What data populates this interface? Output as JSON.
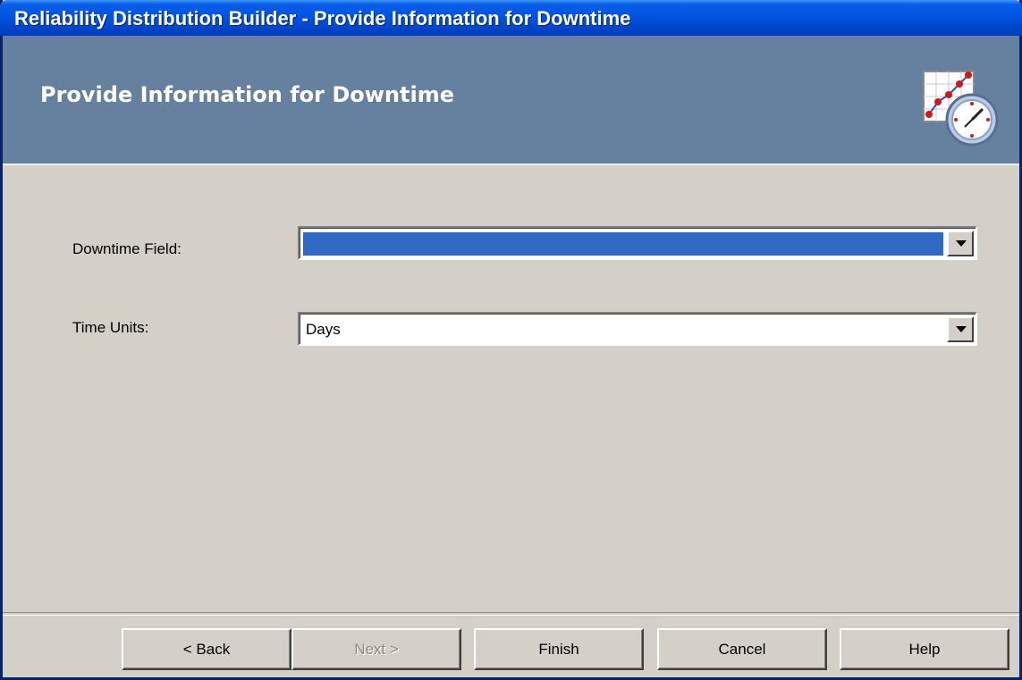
{
  "window": {
    "title": "Reliability Distribution Builder - Provide Information for Downtime"
  },
  "header": {
    "heading": "Provide Information for Downtime",
    "icon": "chart-clock-icon"
  },
  "form": {
    "downtime_field": {
      "label": "Downtime Field:",
      "value": ""
    },
    "time_units": {
      "label": "Time Units:",
      "value": "Days"
    }
  },
  "buttons": {
    "back": "< Back",
    "next": "Next >",
    "finish": "Finish",
    "cancel": "Cancel",
    "help": "Help"
  },
  "colors": {
    "titlebar": "#0054e3",
    "header_bg": "#66819f",
    "dialog_bg": "#d4d0c8",
    "selection": "#316ac5"
  }
}
